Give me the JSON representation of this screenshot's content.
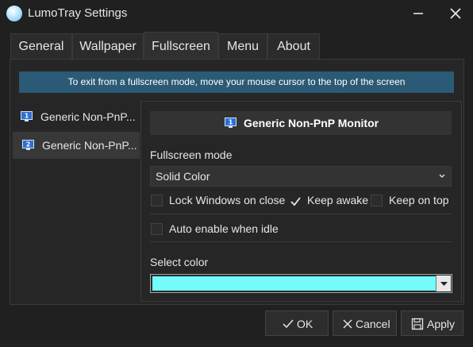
{
  "window": {
    "title": "LumoTray Settings"
  },
  "tabs": [
    {
      "label": "General"
    },
    {
      "label": "Wallpaper"
    },
    {
      "label": "Fullscreen"
    },
    {
      "label": "Menu"
    },
    {
      "label": "About"
    }
  ],
  "banner": {
    "text": "To exit from a fullscreen mode, move your mouse cursor to the top of the screen"
  },
  "monitors": [
    {
      "number": "1",
      "label": "Generic Non-PnP..."
    },
    {
      "number": "2",
      "label": "Generic Non-PnP..."
    }
  ],
  "detail": {
    "header_number": "1",
    "header_title": "Generic Non-PnP Monitor",
    "fullscreen_mode_label": "Fullscreen mode",
    "fullscreen_mode_value": "Solid Color",
    "lock_windows_label": "Lock Windows on close",
    "lock_windows_checked": false,
    "keep_awake_label": "Keep awake",
    "keep_awake_checked": true,
    "keep_on_top_label": "Keep on top",
    "keep_on_top_checked": false,
    "auto_enable_label": "Auto enable when idle",
    "auto_enable_checked": false,
    "select_color_label": "Select color",
    "selected_color": "#74fbfb"
  },
  "buttons": {
    "ok": "OK",
    "cancel": "Cancel",
    "apply": "Apply"
  }
}
